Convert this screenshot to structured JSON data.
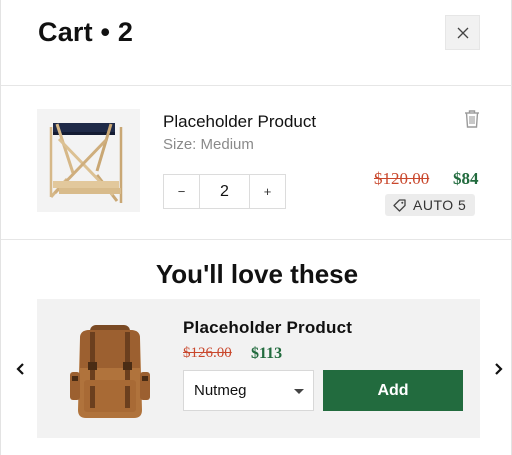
{
  "header": {
    "title": "Cart • 2",
    "close_icon": "close-icon"
  },
  "line_item": {
    "name": "Placeholder Product",
    "variant": "Size: Medium",
    "quantity": "2",
    "qty_minus": "−",
    "qty_plus": "+",
    "compare_price": "$120.00",
    "price": "$84",
    "discount_code": "AUTO 5",
    "image_icon": "folding-stool-image",
    "remove_icon": "trash-icon"
  },
  "recommendations": {
    "heading": "You'll love these",
    "product": {
      "name": "Placeholder Product",
      "compare_price": "$126.00",
      "price": "$113",
      "selected_variant": "Nutmeg",
      "add_label": "Add",
      "image_icon": "backpack-image"
    },
    "prev_icon": "chevron-left-icon",
    "next_icon": "chevron-right-icon"
  },
  "colors": {
    "accent_green": "#226b3e",
    "sale_red": "#c9482d",
    "panel_gray": "#f2f2f2"
  }
}
